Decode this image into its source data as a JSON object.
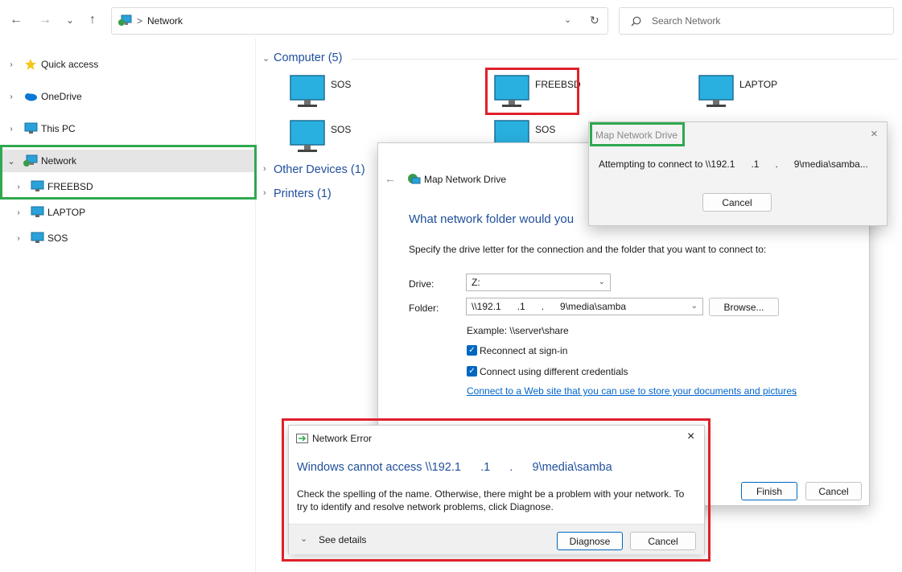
{
  "toolbar": {
    "back_icon": "←",
    "forward_icon": "→",
    "recent_icon": "⌄",
    "up_icon": "↑",
    "address_sep": ">",
    "address_path": "Network",
    "refresh_icon": "↻",
    "search_placeholder": "Search Network"
  },
  "sidebar": {
    "items": [
      {
        "label": "Quick access"
      },
      {
        "label": "OneDrive"
      },
      {
        "label": "This PC"
      },
      {
        "label": "Network"
      },
      {
        "label": "FREEBSD"
      },
      {
        "label": "LAPTOP"
      },
      {
        "label": "SOS"
      }
    ]
  },
  "content": {
    "group_computer": "Computer (5)",
    "group_other": "Other Devices (1)",
    "group_printers": "Printers (1)",
    "computers": [
      {
        "label": "SOS"
      },
      {
        "label": "FREEBSD"
      },
      {
        "label": "LAPTOP"
      },
      {
        "label": "SOS"
      },
      {
        "label": "SOS"
      }
    ]
  },
  "map_drive": {
    "title": "Map Network Drive",
    "heading": "What network folder would you",
    "instruction": "Specify the drive letter for the connection and the folder that you want to connect to:",
    "drive_label": "Drive:",
    "drive_value": "Z:",
    "folder_label": "Folder:",
    "folder_value": "\\\\192.1      .1      .      9\\media\\samba",
    "browse_label": "Browse...",
    "example": "Example: \\\\server\\share",
    "reconnect_label": "Reconnect at sign-in",
    "credentials_label": "Connect using different credentials",
    "web_link": "Connect to a Web site that you can use to store your documents and pictures",
    "web_link_suffix": ".",
    "finish_label": "Finish",
    "cancel_label": "Cancel"
  },
  "connecting": {
    "title": "Map Network Drive",
    "message": "Attempting to connect to \\\\192.1      .1      .      9\\media\\samba...",
    "cancel_label": "Cancel"
  },
  "error": {
    "title": "Network Error",
    "heading": "Windows cannot access \\\\192.1      .1      .      9\\media\\samba",
    "body": "Check the spelling of the name. Otherwise, there might be a problem with your network. To try to identify and resolve network problems, click Diagnose.",
    "details_label": "See details",
    "diagnose_label": "Diagnose",
    "cancel_label": "Cancel"
  },
  "colors": {
    "accent": "#0067c0",
    "link": "#1f4e9c",
    "highlight_red": "#e0202a",
    "highlight_green": "#2fa84f"
  }
}
